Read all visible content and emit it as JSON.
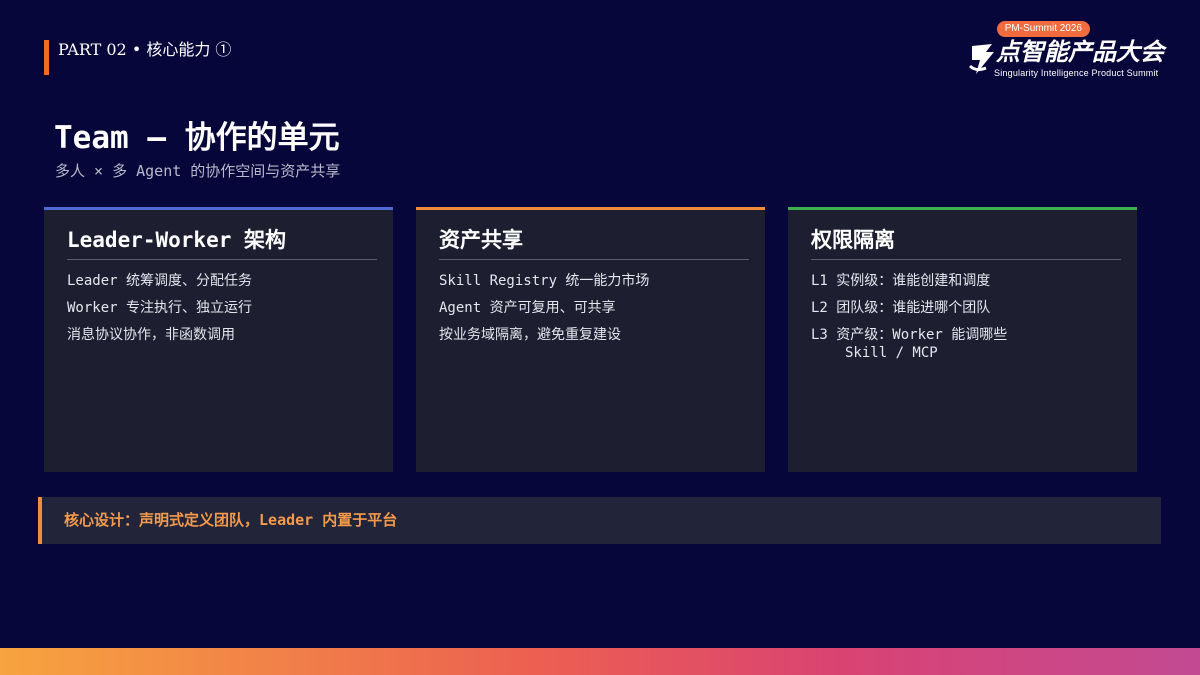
{
  "header": {
    "part_label": "PART 02 • 核心能力 ①"
  },
  "logo": {
    "badge": "PM-Summit 2026",
    "name": "点智能产品大会",
    "subtitle": "Singularity Intelligence Product Summit"
  },
  "title": "Team — 协作的单元",
  "subtitle": "多人 × 多 Agent 的协作空间与资产共享",
  "cards": [
    {
      "heading": "Leader-Worker 架构",
      "accent": "#4d6bd1",
      "items": [
        "Leader 统筹调度、分配任务",
        "Worker 专注执行、独立运行",
        "消息协议协作，非函数调用"
      ]
    },
    {
      "heading": "资产共享",
      "accent": "#f28c3a",
      "items": [
        "Skill Registry 统一能力市场",
        "Agent 资产可复用、可共享",
        "按业务域隔离，避免重复建设"
      ]
    },
    {
      "heading": "权限隔离",
      "accent": "#3bb04f",
      "items": [
        "L1 实例级：谁能创建和调度",
        "L2 团队级：谁能进哪个团队",
        "L3 资产级：Worker 能调哪些",
        "Skill / MCP"
      ]
    }
  ],
  "core_design": "核心设计：声明式定义团队，Leader 内置于平台",
  "colors": {
    "background": "#07063a",
    "accent_orange": "#f36a24",
    "card_bg": "#1d1e30",
    "highlight_text": "#f59a4b"
  }
}
